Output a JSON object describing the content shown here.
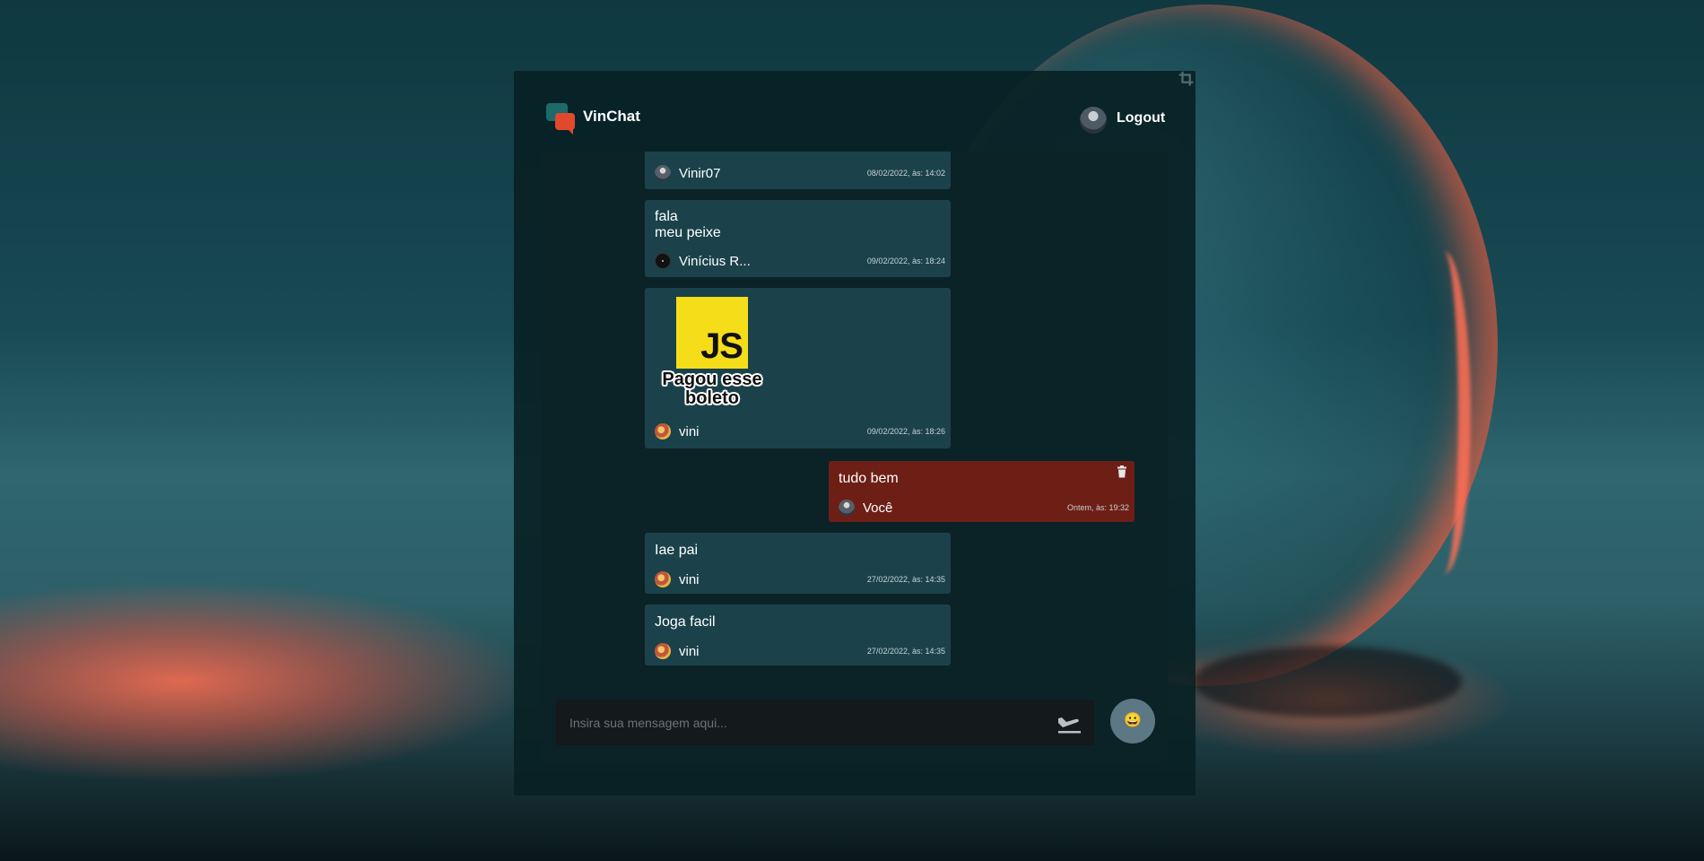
{
  "app": {
    "title": "VinChat",
    "logout_label": "Logout"
  },
  "messages": [
    {
      "text": "",
      "author": "Vinir07",
      "date": "08/02/2022, às: 14:02",
      "own": false
    },
    {
      "text": "fala\nmeu peixe",
      "author": "Vinícius R...",
      "date": "09/02/2022, às: 18:24",
      "own": false
    },
    {
      "image": "js-sticker",
      "image_text": {
        "logo": "JS",
        "caption": "Pagou esse boleto"
      },
      "author": "vini",
      "date": "09/02/2022, às: 18:26",
      "own": false
    },
    {
      "text": "tudo bem",
      "author": "Você",
      "date": "Ontem, às: 19:32",
      "own": true
    },
    {
      "text": "Iae pai",
      "author": "vini",
      "date": "27/02/2022, às: 14:35",
      "own": false
    },
    {
      "text": "Joga facil",
      "author": "vini",
      "date": "27/02/2022, às: 14:35",
      "own": false
    }
  ],
  "composer": {
    "placeholder": "Insira sua mensagem aqui...",
    "emoji": "😀"
  },
  "icons": {
    "crop": "crop-icon",
    "send": "send-plane-icon",
    "trash": "trash-icon",
    "emoji": "emoji-icon"
  },
  "colors": {
    "panel_bg": "#082024",
    "message_bg": "#1b424b",
    "own_message_bg": "#6d1f16",
    "composer_bg": "#14191c",
    "emoji_button_bg": "#5b7884",
    "logo_teal": "#1c6b6a",
    "logo_red": "#e0492e"
  }
}
